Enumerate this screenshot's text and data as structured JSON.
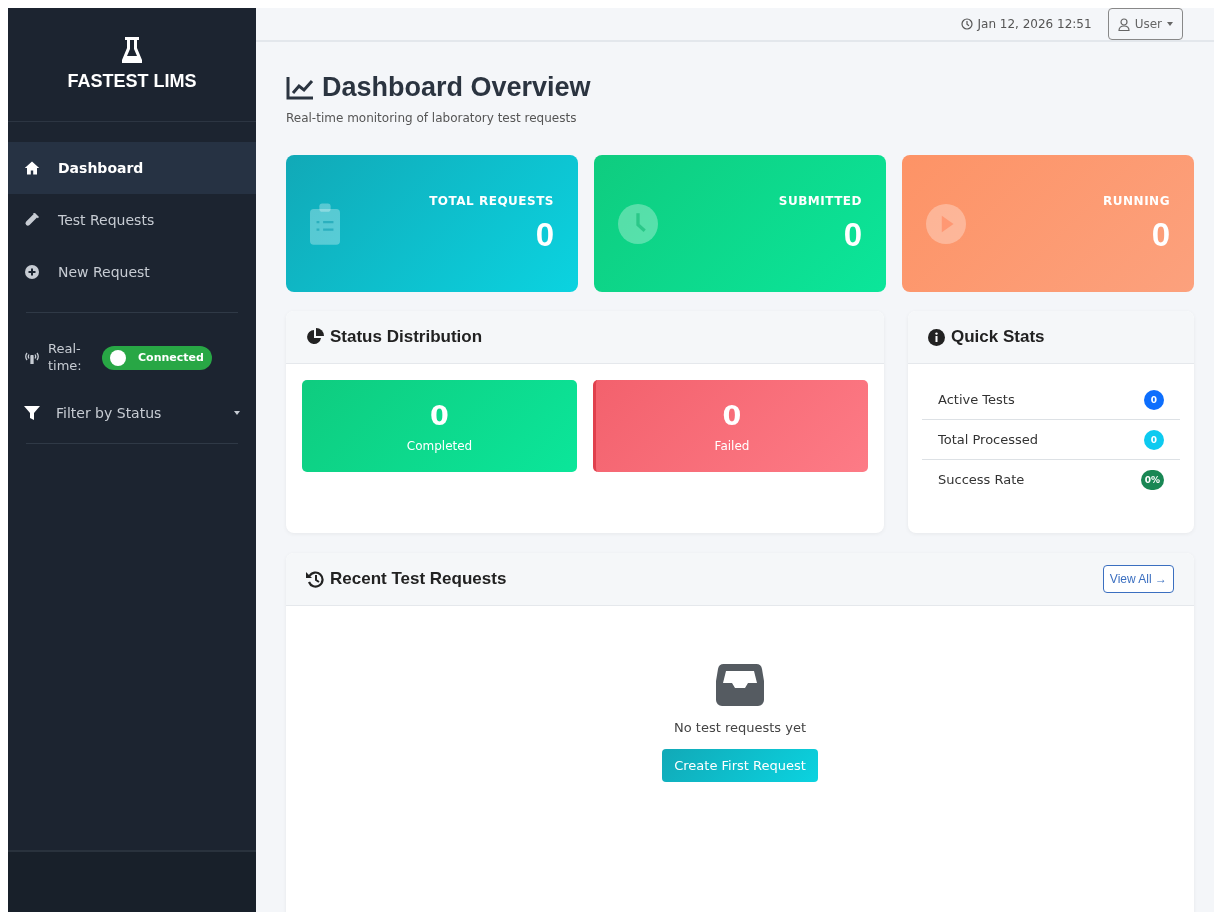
{
  "brand": {
    "name": "FASTEST LIMS"
  },
  "nav": [
    {
      "label": "Dashboard",
      "selected": true
    },
    {
      "label": "Test Requests",
      "selected": false
    },
    {
      "label": "New Request",
      "selected": false
    }
  ],
  "realtime": {
    "label": "Real-time:",
    "status": "Connected",
    "on": true
  },
  "filter": {
    "label": "Filter by Status"
  },
  "header": {
    "datetime": "Jan 12, 2026 12:51",
    "user": "User"
  },
  "page": {
    "title": "Dashboard Overview",
    "subtitle": "Real-time monitoring of laboratory test requests"
  },
  "stat_cards": [
    {
      "kind": "total",
      "label": "TOTAL REQUESTS",
      "value": "0"
    },
    {
      "kind": "submitted",
      "label": "SUBMITTED",
      "value": "0"
    },
    {
      "kind": "running",
      "label": "RUNNING",
      "value": "0"
    }
  ],
  "status_distribution": {
    "title": "Status Distribution",
    "tiles": [
      {
        "kind": "completed",
        "value": "0",
        "label": "Completed"
      },
      {
        "kind": "failed",
        "value": "0",
        "label": "Failed"
      }
    ]
  },
  "quick_stats": {
    "title": "Quick Stats",
    "rows": [
      {
        "label": "Active Tests",
        "value": "0",
        "color": "#0d6efd"
      },
      {
        "label": "Total Processed",
        "value": "0",
        "color": "#0dcaf0"
      },
      {
        "label": "Success Rate",
        "value": "0%",
        "color": "#198754"
      }
    ]
  },
  "recent": {
    "title": "Recent Test Requests",
    "action": "View All →",
    "empty_text": "No test requests yet",
    "button": "Create First Request"
  }
}
